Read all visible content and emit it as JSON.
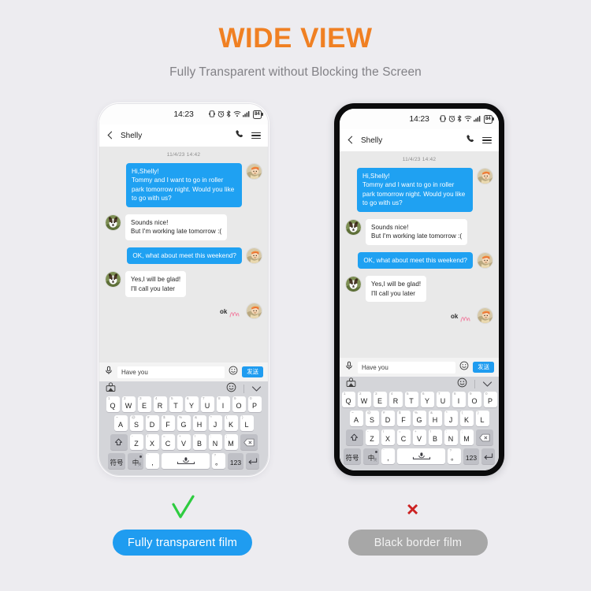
{
  "heading": {
    "title": "WIDE VIEW",
    "subtitle": "Fully Transparent without Blocking the Screen",
    "title_color": "#f08023",
    "subtitle_color": "#828186"
  },
  "background_color": "#edecf0",
  "phone": {
    "status_bar": {
      "time": "14:23",
      "battery_level": "84",
      "icons": [
        "vibrate-icon",
        "alarm-icon",
        "bluetooth-icon",
        "wifi-icon",
        "signal-icon",
        "battery-icon"
      ]
    },
    "chat_header": {
      "back_label": "back-icon",
      "contact_name": "Shelly",
      "call_label": "phone-icon",
      "menu_label": "menu-icon"
    },
    "conversation": {
      "date_divider": "11/4/23 14:42",
      "messages": [
        {
          "side": "out",
          "text": "Hi,Shelly!\nTommy and I want to go in roller park tomorrow night. Would you like to go with us?",
          "avatar": "avatar-self"
        },
        {
          "side": "in",
          "text": "Sounds nice!\nBut I'm working late tomorrow :(",
          "avatar": "avatar-shelly"
        },
        {
          "side": "out",
          "text": "OK, what about meet this weekend?",
          "avatar": "avatar-self"
        },
        {
          "side": "in",
          "text": "Yes,I will be glad!\nI'll call you later",
          "avatar": "avatar-shelly"
        }
      ],
      "sticker_text": "ok"
    },
    "input_bar": {
      "mic_icon": "microphone-icon",
      "text_value": "Have you",
      "placeholder": "Have you",
      "emoji_icon": "smiley-icon",
      "send_label": "发送"
    },
    "keyboard": {
      "toolbar": {
        "sticker_icon": "sticker-icon",
        "emoji_icon": "smiley-icon",
        "collapse_icon": "chevron-down-icon"
      },
      "row1": [
        {
          "sup": "1",
          "main": "Q"
        },
        {
          "sup": "2",
          "main": "W"
        },
        {
          "sup": "3",
          "main": "E"
        },
        {
          "sup": "4",
          "main": "R"
        },
        {
          "sup": "5",
          "main": "T"
        },
        {
          "sup": "6",
          "main": "Y"
        },
        {
          "sup": "7",
          "main": "U"
        },
        {
          "sup": "8",
          "main": "I"
        },
        {
          "sup": "9",
          "main": "O"
        },
        {
          "sup": "0",
          "main": "P"
        }
      ],
      "row2": [
        {
          "sup": "~",
          "main": "A"
        },
        {
          "sup": "@",
          "main": "S"
        },
        {
          "sup": "#",
          "main": "D"
        },
        {
          "sup": "$",
          "main": "F"
        },
        {
          "sup": "%",
          "main": "G"
        },
        {
          "sup": "&",
          "main": "H"
        },
        {
          "sup": "*",
          "main": "J"
        },
        {
          "sup": "(",
          "main": "K"
        },
        {
          "sup": ")",
          "main": "L"
        }
      ],
      "row3": [
        {
          "sup": "-",
          "main": "Z"
        },
        {
          "sup": "/",
          "main": "X"
        },
        {
          "sup": "=",
          "main": "C"
        },
        {
          "sup": "+",
          "main": "V"
        },
        {
          "sup": "!",
          "main": "B"
        },
        {
          "sup": ":",
          "main": "N"
        },
        {
          "sup": ";",
          "main": "M"
        }
      ],
      "shift_label": "shift-icon",
      "backspace_label": "backspace-icon",
      "row4": {
        "symbols": "符号",
        "lang": "中",
        "lang_sub": "英",
        "comma_sup": "‘",
        "comma": ",",
        "space_icon": "microphone-icon",
        "period_sup": "?",
        "period": "。",
        "numbers": "123",
        "enter": "enter-icon"
      }
    }
  },
  "footer": {
    "check_mark": "check-icon",
    "cross_mark": "×",
    "good_label": "Fully transparent film",
    "bad_label": "Black border film",
    "good_color": "#1f9cf0",
    "bad_color": "#a7a7a7"
  }
}
